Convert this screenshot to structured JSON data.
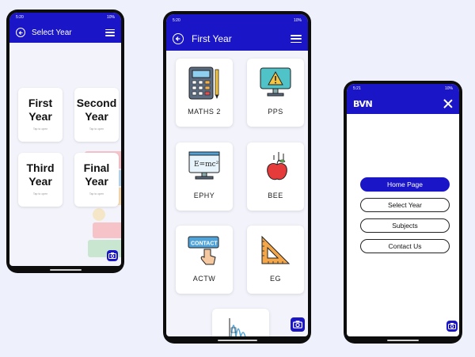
{
  "phone1": {
    "status_time": "5:20",
    "status_battery": "10%",
    "title": "Select Year",
    "years": [
      {
        "name": "First\nYear",
        "hint": "Tap to open"
      },
      {
        "name": "Second\nYear",
        "hint": "Tap to open"
      },
      {
        "name": "Third\nYear",
        "hint": "Tap to open"
      },
      {
        "name": "Final\nYear",
        "hint": "Tap to open"
      }
    ]
  },
  "phone2": {
    "status_time": "5:20",
    "status_battery": "10%",
    "title": "First Year",
    "subjects": [
      {
        "label": "MATHS 2",
        "icon": "calculator-icon"
      },
      {
        "label": "PPS",
        "icon": "monitor-warning-icon"
      },
      {
        "label": "EPHY",
        "icon": "formula-monitor-icon"
      },
      {
        "label": "BEE",
        "icon": "apple-falling-icon"
      },
      {
        "label": "ACTW",
        "icon": "contact-sign-icon"
      },
      {
        "label": "EG",
        "icon": "set-square-ruler-icon"
      }
    ]
  },
  "phone3": {
    "status_time": "5:21",
    "status_battery": "10%",
    "logo": "BVN",
    "menu": [
      "Home Page",
      "Select Year",
      "Subjects",
      "Contact Us"
    ],
    "active_item": "Home Page"
  },
  "colors": {
    "primary": "#1a16c8",
    "background": "#eef0fb"
  }
}
